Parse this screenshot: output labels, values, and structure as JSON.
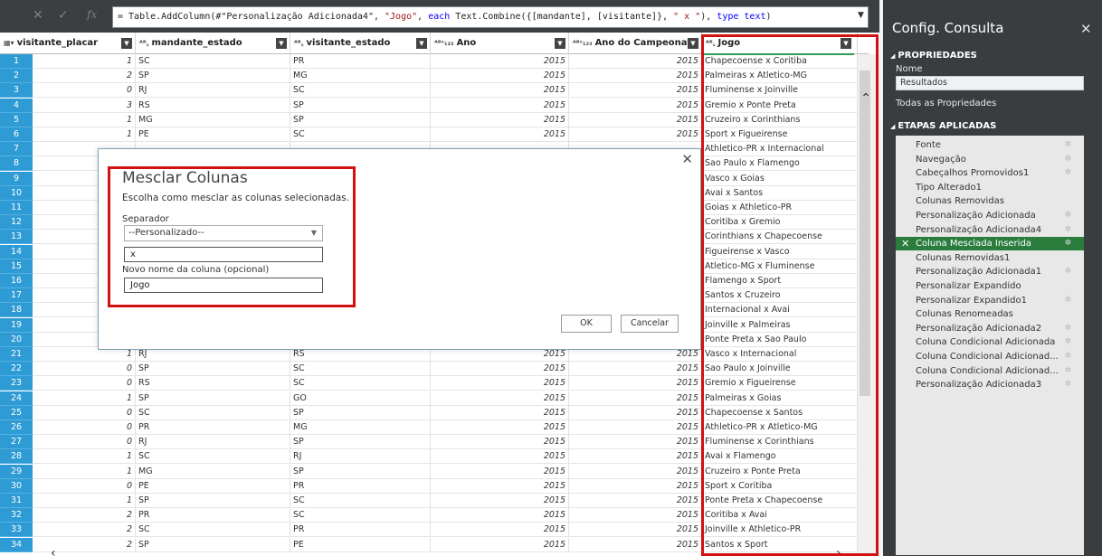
{
  "formula": {
    "cancel_icon": "x-icon",
    "confirm_icon": "check-icon",
    "fx_label": "fx",
    "text_pre": "= Table.AddColumn(#\"Personalização Adicionada4\", ",
    "text_str1": "\"Jogo\"",
    "text_mid1": ", ",
    "text_kw1": "each",
    "text_mid2": " Text.Combine({[mandante], [visitante]}, ",
    "text_str2": "\" x \"",
    "text_mid3": "), ",
    "text_kw2": "type text",
    "text_end": ")"
  },
  "columns": [
    {
      "label": "visitante_placar",
      "type": "",
      "table_icon": true
    },
    {
      "label": "mandante_estado",
      "type": "A B C"
    },
    {
      "label": "visitante_estado",
      "type": "A B C"
    },
    {
      "label": "Ano",
      "type": "ABC 123"
    },
    {
      "label": "Ano do Campeonato",
      "type": "ABC 123"
    },
    {
      "label": "Jogo",
      "type": "A B C"
    }
  ],
  "rows": [
    {
      "n": "1",
      "placar": "1",
      "mand": "SC",
      "vis": "PR",
      "ano": "2015",
      "camp": "2015",
      "jogo": "Chapecoense x Coritiba"
    },
    {
      "n": "2",
      "placar": "2",
      "mand": "SP",
      "vis": "MG",
      "ano": "2015",
      "camp": "2015",
      "jogo": "Palmeiras x Atletico-MG"
    },
    {
      "n": "3",
      "placar": "0",
      "mand": "RJ",
      "vis": "SC",
      "ano": "2015",
      "camp": "2015",
      "jogo": "Fluminense x Joinville"
    },
    {
      "n": "4",
      "placar": "3",
      "mand": "RS",
      "vis": "SP",
      "ano": "2015",
      "camp": "2015",
      "jogo": "Gremio x Ponte Preta"
    },
    {
      "n": "5",
      "placar": "1",
      "mand": "MG",
      "vis": "SP",
      "ano": "2015",
      "camp": "2015",
      "jogo": "Cruzeiro x Corinthians"
    },
    {
      "n": "6",
      "placar": "1",
      "mand": "PE",
      "vis": "SC",
      "ano": "2015",
      "camp": "2015",
      "jogo": "Sport x Figueirense"
    },
    {
      "n": "7",
      "placar": "",
      "mand": "",
      "vis": "",
      "ano": "",
      "camp": "",
      "jogo": "Athletico-PR x Internacional"
    },
    {
      "n": "8",
      "placar": "",
      "mand": "",
      "vis": "",
      "ano": "",
      "camp": "",
      "jogo": "Sao Paulo x Flamengo"
    },
    {
      "n": "9",
      "placar": "",
      "mand": "",
      "vis": "",
      "ano": "",
      "camp": "",
      "jogo": "Vasco x Goias"
    },
    {
      "n": "10",
      "placar": "",
      "mand": "",
      "vis": "",
      "ano": "",
      "camp": "",
      "jogo": "Avai x Santos"
    },
    {
      "n": "11",
      "placar": "",
      "mand": "",
      "vis": "",
      "ano": "",
      "camp": "",
      "jogo": "Goias x Athletico-PR"
    },
    {
      "n": "12",
      "placar": "",
      "mand": "",
      "vis": "",
      "ano": "",
      "camp": "",
      "jogo": "Coritiba x Gremio"
    },
    {
      "n": "13",
      "placar": "",
      "mand": "",
      "vis": "",
      "ano": "",
      "camp": "",
      "jogo": "Corinthians x Chapecoense"
    },
    {
      "n": "14",
      "placar": "",
      "mand": "",
      "vis": "",
      "ano": "",
      "camp": "",
      "jogo": "Figueirense x Vasco"
    },
    {
      "n": "15",
      "placar": "",
      "mand": "",
      "vis": "",
      "ano": "",
      "camp": "",
      "jogo": "Atletico-MG x Fluminense"
    },
    {
      "n": "16",
      "placar": "",
      "mand": "",
      "vis": "",
      "ano": "",
      "camp": "",
      "jogo": "Flamengo x Sport"
    },
    {
      "n": "17",
      "placar": "",
      "mand": "",
      "vis": "",
      "ano": "",
      "camp": "",
      "jogo": "Santos x Cruzeiro"
    },
    {
      "n": "18",
      "placar": "",
      "mand": "",
      "vis": "",
      "ano": "",
      "camp": "",
      "jogo": "Internacional x Avai"
    },
    {
      "n": "19",
      "placar": "",
      "mand": "",
      "vis": "",
      "ano": "",
      "camp": "",
      "jogo": "Joinville x Palmeiras"
    },
    {
      "n": "20",
      "placar": "",
      "mand": "",
      "vis": "",
      "ano": "",
      "camp": "",
      "jogo": "Ponte Preta x Sao Paulo"
    },
    {
      "n": "21",
      "placar": "1",
      "mand": "RJ",
      "vis": "RS",
      "ano": "2015",
      "camp": "2015",
      "jogo": "Vasco x Internacional"
    },
    {
      "n": "22",
      "placar": "0",
      "mand": "SP",
      "vis": "SC",
      "ano": "2015",
      "camp": "2015",
      "jogo": "Sao Paulo x Joinville"
    },
    {
      "n": "23",
      "placar": "0",
      "mand": "RS",
      "vis": "SC",
      "ano": "2015",
      "camp": "2015",
      "jogo": "Gremio x Figueirense"
    },
    {
      "n": "24",
      "placar": "1",
      "mand": "SP",
      "vis": "GO",
      "ano": "2015",
      "camp": "2015",
      "jogo": "Palmeiras x Goias"
    },
    {
      "n": "25",
      "placar": "0",
      "mand": "SC",
      "vis": "SP",
      "ano": "2015",
      "camp": "2015",
      "jogo": "Chapecoense x Santos"
    },
    {
      "n": "26",
      "placar": "0",
      "mand": "PR",
      "vis": "MG",
      "ano": "2015",
      "camp": "2015",
      "jogo": "Athletico-PR x Atletico-MG"
    },
    {
      "n": "27",
      "placar": "0",
      "mand": "RJ",
      "vis": "SP",
      "ano": "2015",
      "camp": "2015",
      "jogo": "Fluminense x Corinthians"
    },
    {
      "n": "28",
      "placar": "1",
      "mand": "SC",
      "vis": "RJ",
      "ano": "2015",
      "camp": "2015",
      "jogo": "Avai x Flamengo"
    },
    {
      "n": "29",
      "placar": "1",
      "mand": "MG",
      "vis": "SP",
      "ano": "2015",
      "camp": "2015",
      "jogo": "Cruzeiro x Ponte Preta"
    },
    {
      "n": "30",
      "placar": "0",
      "mand": "PE",
      "vis": "PR",
      "ano": "2015",
      "camp": "2015",
      "jogo": "Sport x Coritiba"
    },
    {
      "n": "31",
      "placar": "1",
      "mand": "SP",
      "vis": "SC",
      "ano": "2015",
      "camp": "2015",
      "jogo": "Ponte Preta x Chapecoense"
    },
    {
      "n": "32",
      "placar": "2",
      "mand": "PR",
      "vis": "SC",
      "ano": "2015",
      "camp": "2015",
      "jogo": "Coritiba x Avai"
    },
    {
      "n": "33",
      "placar": "2",
      "mand": "SC",
      "vis": "PR",
      "ano": "2015",
      "camp": "2015",
      "jogo": "Joinville x Athletico-PR"
    },
    {
      "n": "34",
      "placar": "2",
      "mand": "SP",
      "vis": "PE",
      "ano": "2015",
      "camp": "2015",
      "jogo": "Santos x Sport"
    }
  ],
  "dialog": {
    "title": "Mesclar Colunas",
    "description": "Escolha como mesclar as colunas selecionadas.",
    "separator_label": "Separador",
    "separator_value": "--Personalizado--",
    "custom_separator": "x",
    "new_name_label": "Novo nome da coluna (opcional)",
    "new_name_value": "Jogo",
    "ok_label": "OK",
    "cancel_label": "Cancelar"
  },
  "pane": {
    "title": "Config. Consulta",
    "properties_heading": "PROPRIEDADES",
    "name_label": "Nome",
    "name_value": "Resultados",
    "all_properties_link": "Todas as Propriedades",
    "steps_heading": "ETAPAS APLICADAS",
    "steps": [
      {
        "label": "Fonte",
        "gear": true
      },
      {
        "label": "Navegação",
        "gear": true
      },
      {
        "label": "Cabeçalhos Promovidos1",
        "gear": true
      },
      {
        "label": "Tipo Alterado1",
        "gear": false
      },
      {
        "label": "Colunas Removidas",
        "gear": false
      },
      {
        "label": "Personalização Adicionada",
        "gear": true
      },
      {
        "label": "Personalização Adicionada4",
        "gear": true
      },
      {
        "label": "Coluna Mesclada Inserida",
        "gear": true,
        "selected": true
      },
      {
        "label": "Colunas Removidas1",
        "gear": false
      },
      {
        "label": "Personalização Adicionada1",
        "gear": true
      },
      {
        "label": "Personalizar Expandido",
        "gear": false
      },
      {
        "label": "Personalizar Expandido1",
        "gear": true
      },
      {
        "label": "Colunas Renomeadas",
        "gear": false
      },
      {
        "label": "Personalização Adicionada2",
        "gear": true
      },
      {
        "label": "Coluna Condicional Adicionada",
        "gear": true
      },
      {
        "label": "Coluna Condicional Adicionad...",
        "gear": true
      },
      {
        "label": "Coluna Condicional Adicionad...",
        "gear": true
      },
      {
        "label": "Personalização Adicionada3",
        "gear": true
      }
    ]
  },
  "colors": {
    "row_number_bg": "#2f9bd4",
    "pane_bg": "#3a3d40",
    "selected_step": "#2b7d3e",
    "highlight_red": "#d11010"
  }
}
